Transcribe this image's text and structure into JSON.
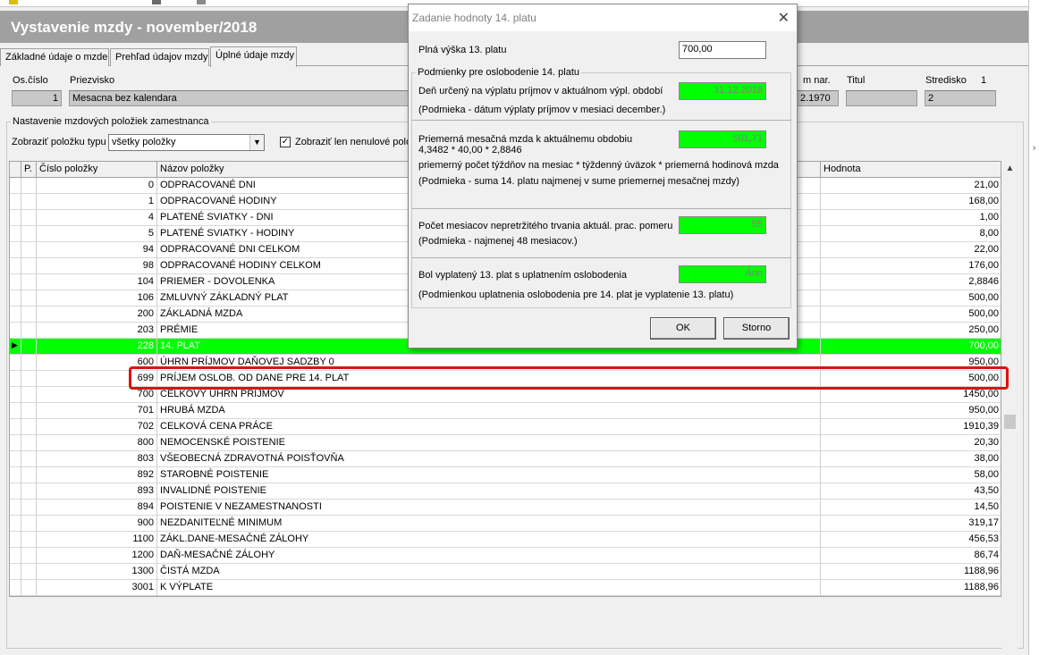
{
  "window": {
    "title": "Vystavenie mzdy -  november/2018"
  },
  "tabs": [
    {
      "label": "Základné údaje o mzde"
    },
    {
      "label": "Prehľad údajov mzdy"
    },
    {
      "label": "Úplné údaje mzdy"
    }
  ],
  "employee": {
    "os_cislo_label": "Os.číslo",
    "os_cislo_value": "1",
    "priezvisko_label": "Priezvisko",
    "priezvisko_value": "Mesacna bez kalendara",
    "datum_label": "m nar.",
    "datum_value": "2.1970",
    "titul_label": "Titul",
    "titul_value": "",
    "stredisko_label": "Stredisko",
    "stredisko_num": "1",
    "stredisko_value": "2"
  },
  "settings": {
    "group_title": "Nastavenie mzdových položiek zamestnanca",
    "type_label": "Zobraziť položku typu",
    "type_value": "všetky položky",
    "checkbox_label": "Zobraziť len nenulové polo",
    "checkbox_checked": "✓"
  },
  "grid": {
    "headers": {
      "p": "P.",
      "num": "Číslo položky",
      "name": "Názov položky",
      "value": "Hodnota"
    },
    "rows": [
      {
        "num": "0",
        "name": "ODPRACOVANÉ DNI",
        "value": "21,00"
      },
      {
        "num": "1",
        "name": "ODPRACOVANÉ HODINY",
        "value": "168,00"
      },
      {
        "num": "4",
        "name": "PLATENÉ SVIATKY - DNI",
        "value": "1,00"
      },
      {
        "num": "5",
        "name": "PLATENÉ SVIATKY - HODINY",
        "value": "8,00"
      },
      {
        "num": "94",
        "name": "ODPRACOVANÉ DNI CELKOM",
        "value": "22,00"
      },
      {
        "num": "98",
        "name": "ODPRACOVANÉ HODINY CELKOM",
        "value": "176,00"
      },
      {
        "num": "104",
        "name": "PRIEMER - DOVOLENKA",
        "value": "2,8846"
      },
      {
        "num": "106",
        "name": "ZMLUVNÝ ZÁKLADNÝ PLAT",
        "value": "500,00"
      },
      {
        "num": "200",
        "name": "ZÁKLADNÁ MZDA",
        "value": "500,00"
      },
      {
        "num": "203",
        "name": "PRÉMIE",
        "value": "250,00"
      },
      {
        "num": "228",
        "name": "14. PLAT",
        "value": "700,00"
      },
      {
        "num": "600",
        "name": "ÚHRN PRÍJMOV DAŇOVEJ SADZBY 0",
        "value": "950,00"
      },
      {
        "num": "699",
        "name": "PRÍJEM OSLOB. OD DANE PRE 14. PLAT",
        "value": "500,00"
      },
      {
        "num": "700",
        "name": "CELKOVÝ ÚHRN PRÍJMOV",
        "value": "1450,00"
      },
      {
        "num": "701",
        "name": "HRUBÁ MZDA",
        "value": "950,00"
      },
      {
        "num": "702",
        "name": "CELKOVÁ CENA PRÁCE",
        "value": "1910,39"
      },
      {
        "num": "800",
        "name": "NEMOCENSKÉ POISTENIE",
        "value": "20,30"
      },
      {
        "num": "803",
        "name": "VŠEOBECNÁ ZDRAVOTNÁ POISŤOVŇA",
        "value": "38,00"
      },
      {
        "num": "892",
        "name": "STAROBNÉ POISTENIE",
        "value": "58,00"
      },
      {
        "num": "893",
        "name": "INVALIDNÉ POISTENIE",
        "value": "43,50"
      },
      {
        "num": "894",
        "name": "POISTENIE V NEZAMESTNANOSTI",
        "value": "14,50"
      },
      {
        "num": "900",
        "name": "NEZDANITEĽNÉ MINIMUM",
        "value": "319,17"
      },
      {
        "num": "1100",
        "name": "ZÁKL.DANE-MESAČNÉ ZÁLOHY",
        "value": "456,53"
      },
      {
        "num": "1200",
        "name": "DAŇ-MESAČNÉ ZÁLOHY",
        "value": "86,74"
      },
      {
        "num": "1300",
        "name": "ČISTÁ MZDA",
        "value": "1188,96"
      },
      {
        "num": "3001",
        "name": "K VÝPLATE",
        "value": "1188,96"
      }
    ],
    "selected_index": 10,
    "highlighted_index": 12,
    "row_indicator": "▶"
  },
  "dialog": {
    "title": "Zadanie hodnoty 14. platu",
    "close": "✕",
    "full13_label": "Plná výška 13. platu",
    "full13_value": "700,00",
    "group_title": "Podmienky pre oslobodenie 14. platu",
    "date_label": "Deň určený na výplatu príjmov v aktuálnom výpl. období",
    "date_value": "31.12.2018",
    "date_note": "(Podmieka - dátum výplaty príjmov v mesiaci december.)",
    "avg_label": "Priemerná mesačná mzda k aktuálnemu obdobiu",
    "avg_value": "501,71",
    "avg_formula": "4,3482  *  40,00  *  2,8846",
    "avg_formula_desc": "priemerný počet týždňov na mesiac * týždenný úväzok * priemerná hodinová mzda",
    "avg_note": "(Podmieka - suma 14. platu najmenej v sume priemernej mesačnej mzdy)",
    "months_label": "Počet mesiacov nepretržitého trvania aktuál. prac. pomeru",
    "months_value": "55",
    "months_note": "(Podmieka - najmenej 48 mesiacov.)",
    "paid13_label": "Bol vyplatený 13. plat s uplatnením oslobodenia",
    "paid13_value": "Áno",
    "paid13_note": "(Podmienkou uplatnenia oslobodenia pre 14. plat je vyplatenie 13. platu)",
    "ok_label": "OK",
    "cancel_label": "Storno"
  },
  "colors": {
    "selected_row": "#00ff00",
    "highlight_border": "#e01010",
    "titlebar": "#a0a0a0"
  }
}
